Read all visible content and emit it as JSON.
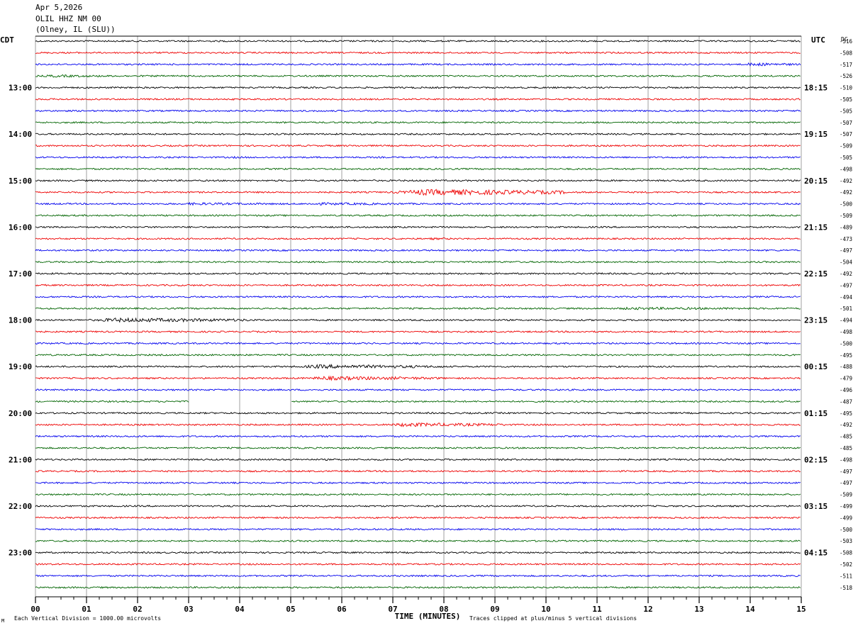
{
  "header": {
    "date": "Apr 5,2026",
    "station": "OLIL HHZ NM 00",
    "location": "(Olney, IL (SLU))"
  },
  "labels": {
    "left_tz": "CDT",
    "right_tz": "UTC",
    "dc_header": "DC",
    "xlabel": "TIME (MINUTES)",
    "footer_left": "Each Vertical Division = 1000.00 microvolts",
    "footer_right": "Traces clipped at plus/minus 5 vertical divisions",
    "corner_mark": "M"
  },
  "chart_data": {
    "type": "line",
    "title": "OLIL HHZ NM 00",
    "xlabel": "TIME (MINUTES)",
    "xlim": [
      0,
      15
    ],
    "x_ticks": [
      "00",
      "01",
      "02",
      "03",
      "04",
      "05",
      "06",
      "07",
      "08",
      "09",
      "10",
      "11",
      "12",
      "13",
      "14",
      "15"
    ],
    "trace_colors": [
      "#000000",
      "#ee0000",
      "#0000ee",
      "#006400"
    ],
    "left_hour_labels": [
      "13:00",
      "14:00",
      "15:00",
      "16:00",
      "17:00",
      "18:00",
      "19:00",
      "20:00",
      "21:00",
      "22:00",
      "23:00"
    ],
    "right_hour_labels": [
      "18:15",
      "19:15",
      "20:15",
      "21:15",
      "22:15",
      "23:15",
      "00:15",
      "01:15",
      "02:15",
      "03:15",
      "04:15"
    ],
    "dc_offsets": [
      -516,
      -508,
      -517,
      -526,
      -510,
      -505,
      -505,
      -507,
      -507,
      -509,
      -505,
      -498,
      -492,
      -492,
      -500,
      -509,
      -489,
      -473,
      -497,
      -504,
      -492,
      -497,
      -494,
      -501,
      -494,
      -498,
      -500,
      -495,
      -488,
      -479,
      -496,
      -487,
      -495,
      -492,
      -485,
      -485,
      -498,
      -497,
      -497,
      -509,
      -499,
      -499,
      -500,
      -503,
      -508,
      -502,
      -511,
      -518
    ],
    "events": [
      {
        "row": 3,
        "start_min": 0.0,
        "end_min": 1.8,
        "amp": 2.0
      },
      {
        "row": 10,
        "start_min": 3.7,
        "end_min": 4.6,
        "amp": 1.5
      },
      {
        "row": 14,
        "start_min": 5.0,
        "end_min": 8.0,
        "amp": 2.0
      },
      {
        "row": 13,
        "start_min": 7.0,
        "end_min": 10.4,
        "amp": 4.5
      },
      {
        "row": 14,
        "start_min": 2.6,
        "end_min": 5.2,
        "amp": 2.0
      },
      {
        "row": 2,
        "start_min": 13.8,
        "end_min": 15.0,
        "amp": 2.5
      },
      {
        "row": 23,
        "start_min": 11.0,
        "end_min": 15.0,
        "amp": 2.0
      },
      {
        "row": 24,
        "start_min": 1.0,
        "end_min": 4.2,
        "amp": 3.2
      },
      {
        "row": 28,
        "start_min": 5.0,
        "end_min": 8.0,
        "amp": 3.0
      },
      {
        "row": 29,
        "start_min": 5.2,
        "end_min": 8.0,
        "amp": 3.0
      },
      {
        "row": 33,
        "start_min": 6.8,
        "end_min": 9.2,
        "amp": 3.0
      },
      {
        "row": 17,
        "start_min": 7.5,
        "end_min": 9.0,
        "amp": 1.6
      },
      {
        "row": 36,
        "start_min": 9.0,
        "end_min": 10.2,
        "amp": 1.5
      }
    ],
    "gaps": [
      {
        "row": 31,
        "start_min": 3.0,
        "end_min": 5.0
      }
    ]
  }
}
